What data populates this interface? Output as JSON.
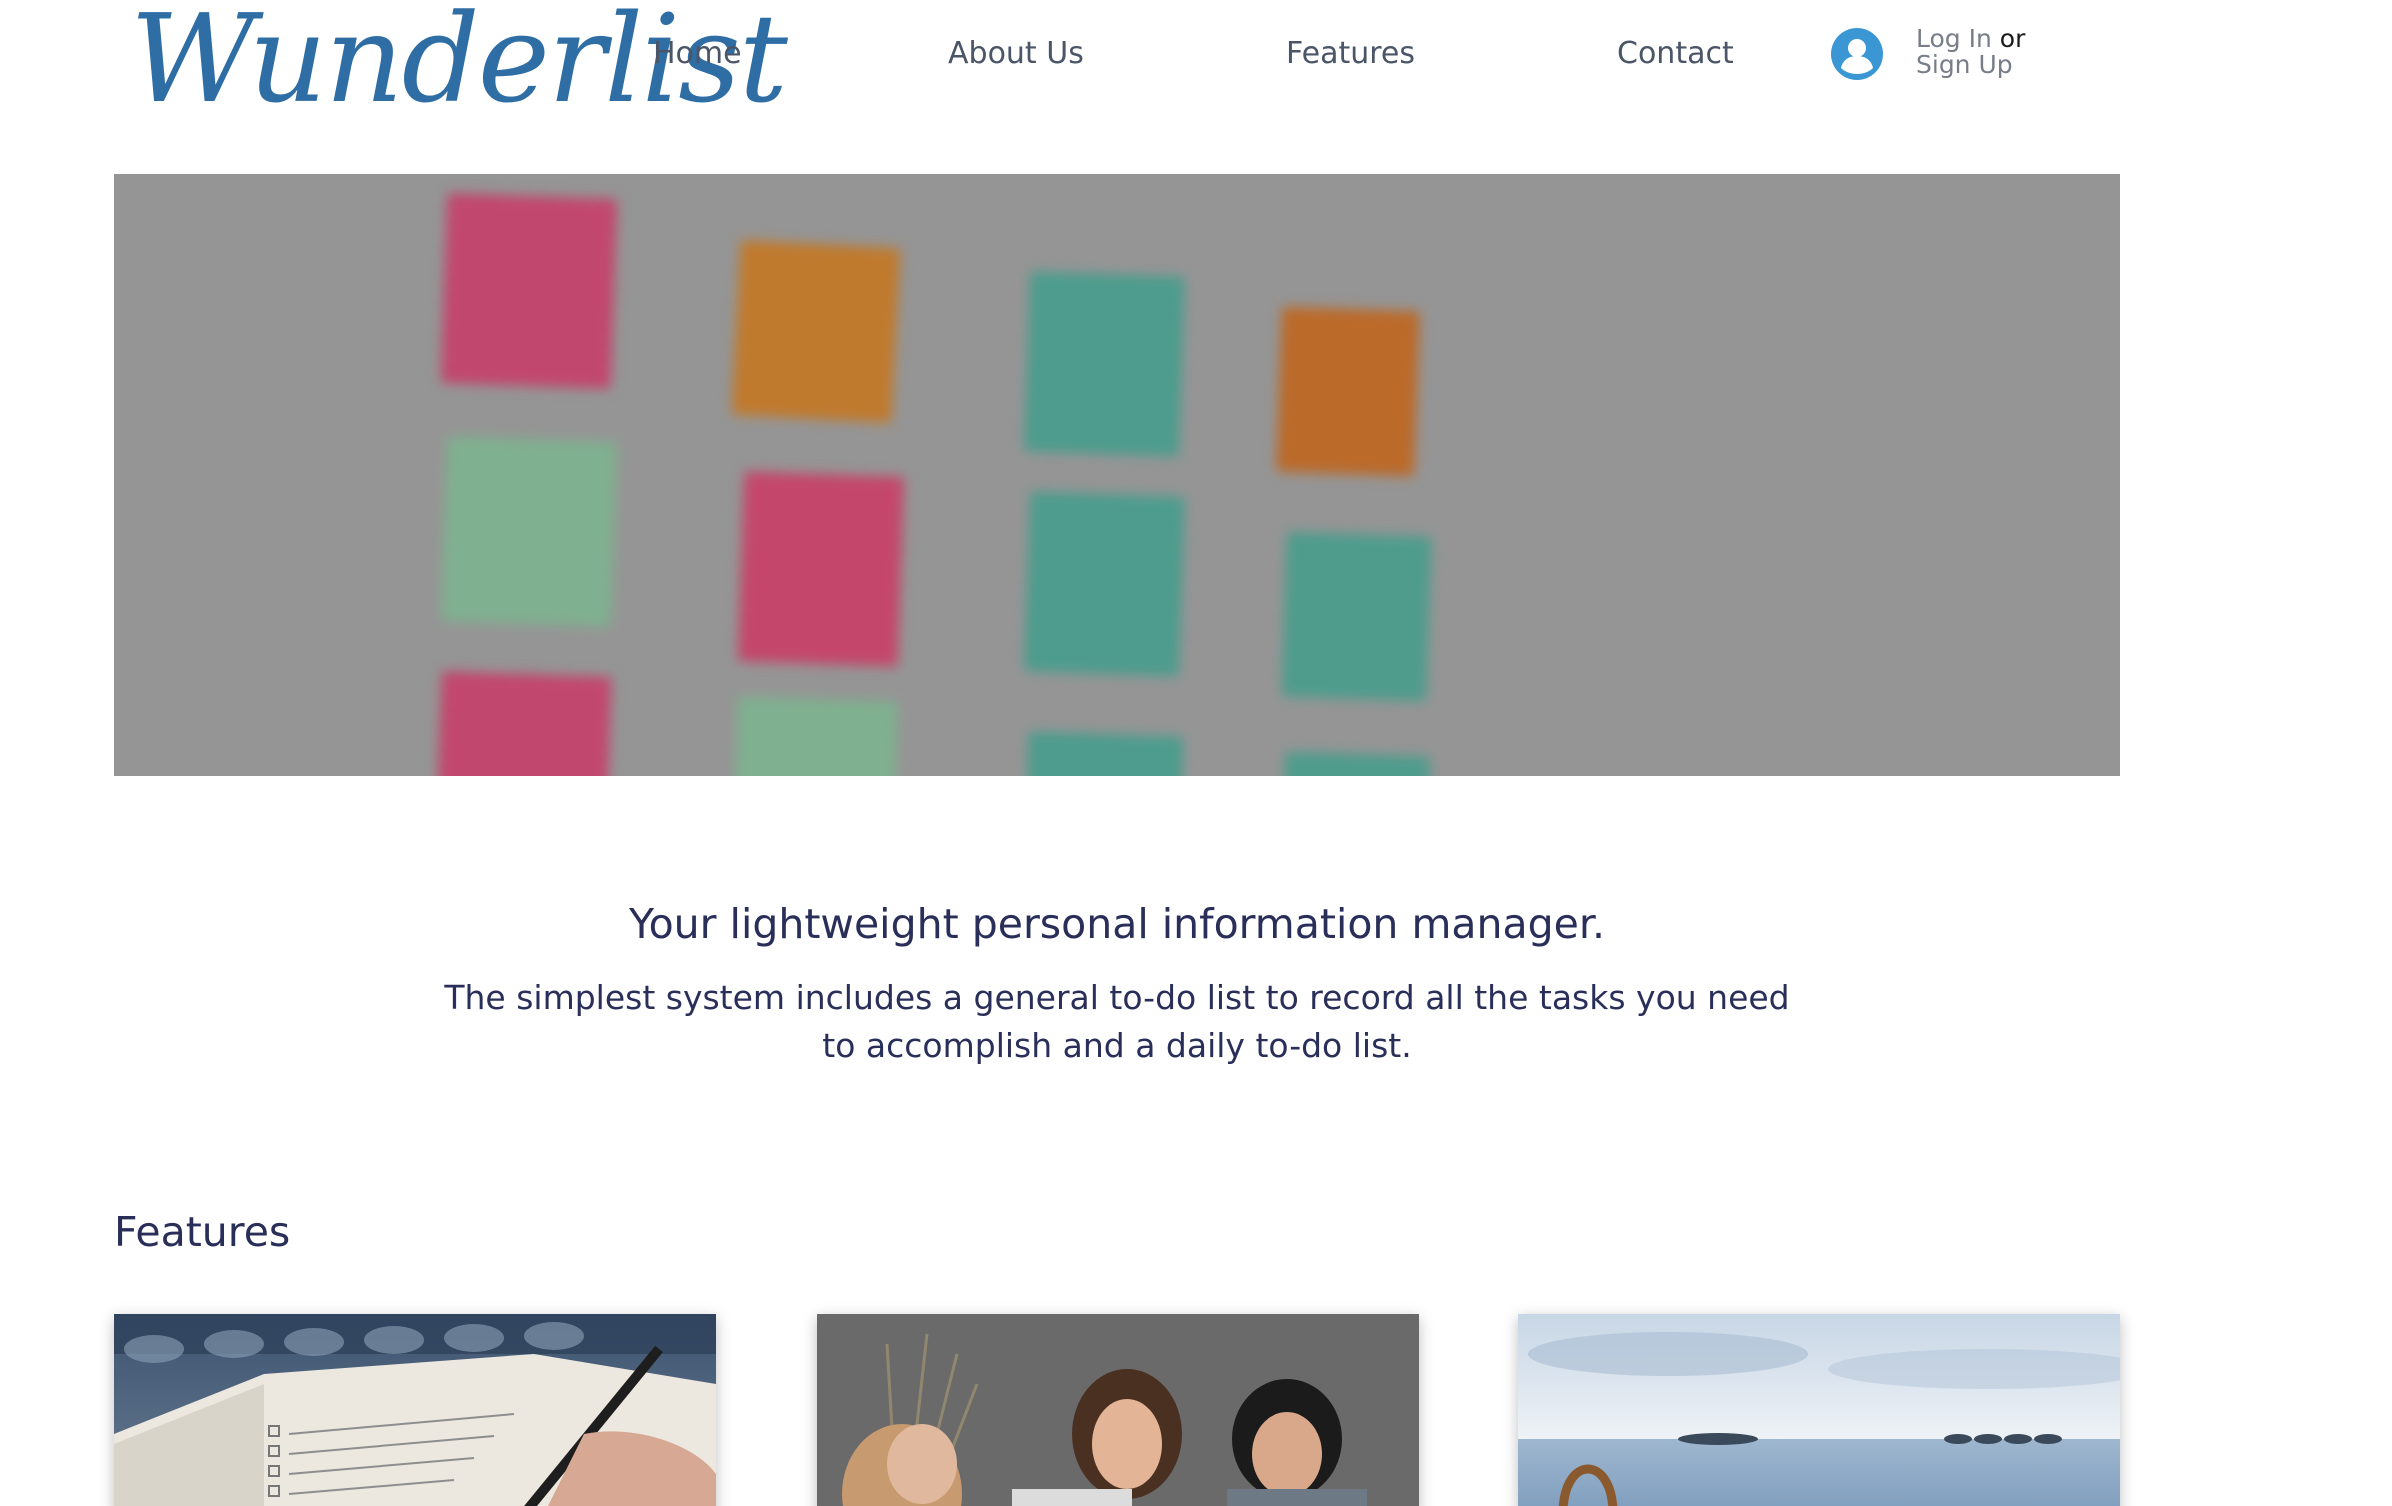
{
  "logo": {
    "text": "Wunderlist"
  },
  "nav": {
    "items": [
      {
        "label": "Home"
      },
      {
        "label": "About Us"
      },
      {
        "label": "Features"
      },
      {
        "label": "Contact"
      }
    ]
  },
  "auth": {
    "login_label": "Log In",
    "or_label": "or",
    "signup_label": "Sign Up"
  },
  "hero": {
    "image": "blurred sticky notes on a wall"
  },
  "intro": {
    "tagline": "Your lightweight personal information manager.",
    "description": "The simplest system includes a general to-do list to record all the tasks you need to accomplish and a daily to-do list."
  },
  "features": {
    "heading": "Features",
    "cards": [
      {
        "image": "hand writing a checklist in a notebook"
      },
      {
        "image": "three people laughing around a laptop"
      },
      {
        "image": "bag on a pier by the sea"
      }
    ]
  },
  "colors": {
    "brand": "#2f6ea5",
    "heading_text": "#2a2f5a",
    "nav_text": "#4a5568",
    "hero_overlay": "#959595"
  }
}
